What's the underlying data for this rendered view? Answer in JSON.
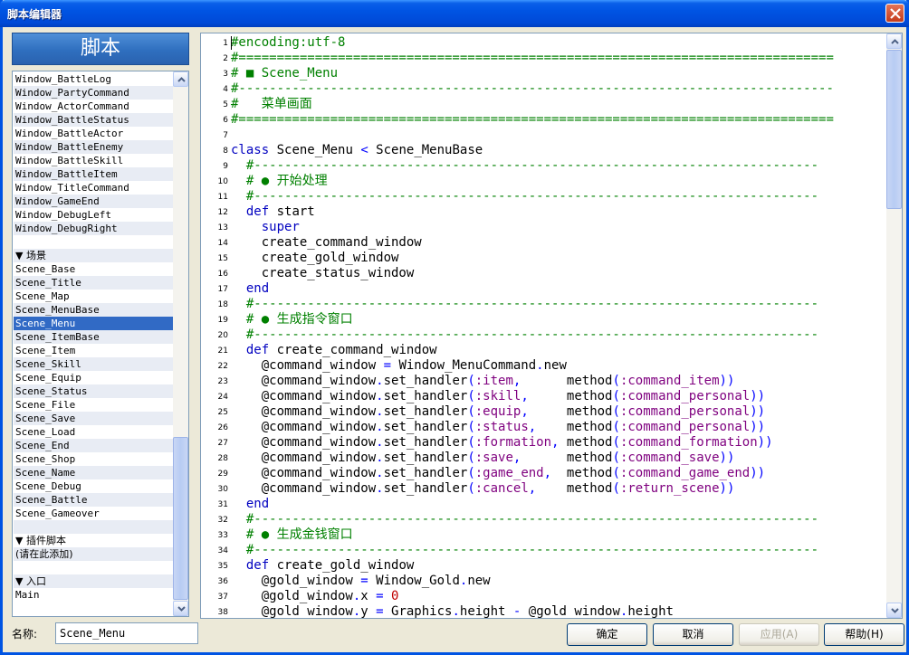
{
  "window": {
    "title": "脚本编辑器"
  },
  "sidebar": {
    "header": "脚本",
    "items": [
      {
        "label": "Window_BattleLog",
        "type": "item"
      },
      {
        "label": "Window_PartyCommand",
        "type": "item"
      },
      {
        "label": "Window_ActorCommand",
        "type": "item"
      },
      {
        "label": "Window_BattleStatus",
        "type": "item"
      },
      {
        "label": "Window_BattleActor",
        "type": "item"
      },
      {
        "label": "Window_BattleEnemy",
        "type": "item"
      },
      {
        "label": "Window_BattleSkill",
        "type": "item"
      },
      {
        "label": "Window_BattleItem",
        "type": "item"
      },
      {
        "label": "Window_TitleCommand",
        "type": "item"
      },
      {
        "label": "Window_GameEnd",
        "type": "item"
      },
      {
        "label": "Window_DebugLeft",
        "type": "item"
      },
      {
        "label": "Window_DebugRight",
        "type": "item"
      },
      {
        "label": "",
        "type": "blank"
      },
      {
        "label": "▼ 场景",
        "type": "group"
      },
      {
        "label": "Scene_Base",
        "type": "item"
      },
      {
        "label": "Scene_Title",
        "type": "item"
      },
      {
        "label": "Scene_Map",
        "type": "item"
      },
      {
        "label": "Scene_MenuBase",
        "type": "item"
      },
      {
        "label": "Scene_Menu",
        "type": "item",
        "selected": true
      },
      {
        "label": "Scene_ItemBase",
        "type": "item"
      },
      {
        "label": "Scene_Item",
        "type": "item"
      },
      {
        "label": "Scene_Skill",
        "type": "item"
      },
      {
        "label": "Scene_Equip",
        "type": "item"
      },
      {
        "label": "Scene_Status",
        "type": "item"
      },
      {
        "label": "Scene_File",
        "type": "item"
      },
      {
        "label": "Scene_Save",
        "type": "item"
      },
      {
        "label": "Scene_Load",
        "type": "item"
      },
      {
        "label": "Scene_End",
        "type": "item"
      },
      {
        "label": "Scene_Shop",
        "type": "item"
      },
      {
        "label": "Scene_Name",
        "type": "item"
      },
      {
        "label": "Scene_Debug",
        "type": "item"
      },
      {
        "label": "Scene_Battle",
        "type": "item"
      },
      {
        "label": "Scene_Gameover",
        "type": "item"
      },
      {
        "label": "",
        "type": "blank"
      },
      {
        "label": "▼ 插件脚本",
        "type": "group"
      },
      {
        "label": "(请在此添加)",
        "type": "group"
      },
      {
        "label": "",
        "type": "blank"
      },
      {
        "label": "▼ 入口",
        "type": "group"
      },
      {
        "label": "Main",
        "type": "item"
      }
    ]
  },
  "editor": {
    "lines": [
      [
        [
          "com",
          "#encoding:utf-8"
        ]
      ],
      [
        [
          "com",
          "#=============================================================================="
        ]
      ],
      [
        [
          "com",
          "# ■ Scene_Menu"
        ]
      ],
      [
        [
          "com",
          "#------------------------------------------------------------------------------"
        ]
      ],
      [
        [
          "com",
          "#   菜单画面"
        ]
      ],
      [
        [
          "com",
          "#=============================================================================="
        ]
      ],
      [],
      [
        [
          "kw",
          "class"
        ],
        [
          "txt",
          " Scene_Menu "
        ],
        [
          "op",
          "<"
        ],
        [
          "txt",
          " Scene_MenuBase"
        ]
      ],
      [
        [
          "com",
          "  #--------------------------------------------------------------------------"
        ]
      ],
      [
        [
          "com",
          "  # ● 开始处理"
        ]
      ],
      [
        [
          "com",
          "  #--------------------------------------------------------------------------"
        ]
      ],
      [
        [
          "kw",
          "  def"
        ],
        [
          "txt",
          " start"
        ]
      ],
      [
        [
          "kw",
          "    super"
        ]
      ],
      [
        [
          "txt",
          "    create_command_window"
        ]
      ],
      [
        [
          "txt",
          "    create_gold_window"
        ]
      ],
      [
        [
          "txt",
          "    create_status_window"
        ]
      ],
      [
        [
          "kw",
          "  end"
        ]
      ],
      [
        [
          "com",
          "  #--------------------------------------------------------------------------"
        ]
      ],
      [
        [
          "com",
          "  # ● 生成指令窗口"
        ]
      ],
      [
        [
          "com",
          "  #--------------------------------------------------------------------------"
        ]
      ],
      [
        [
          "kw",
          "  def"
        ],
        [
          "txt",
          " create_command_window"
        ]
      ],
      [
        [
          "txt",
          "    @command_window "
        ],
        [
          "op",
          "="
        ],
        [
          "txt",
          " Window_MenuCommand"
        ],
        [
          "op",
          "."
        ],
        [
          "txt",
          "new"
        ]
      ],
      [
        [
          "txt",
          "    @command_window"
        ],
        [
          "op",
          "."
        ],
        [
          "txt",
          "set_handler"
        ],
        [
          "op",
          "("
        ],
        [
          "sym",
          ":item"
        ],
        [
          "op",
          ","
        ],
        [
          "txt",
          "      method"
        ],
        [
          "op",
          "("
        ],
        [
          "sym",
          ":command_item"
        ],
        [
          "op",
          "))"
        ]
      ],
      [
        [
          "txt",
          "    @command_window"
        ],
        [
          "op",
          "."
        ],
        [
          "txt",
          "set_handler"
        ],
        [
          "op",
          "("
        ],
        [
          "sym",
          ":skill"
        ],
        [
          "op",
          ","
        ],
        [
          "txt",
          "     method"
        ],
        [
          "op",
          "("
        ],
        [
          "sym",
          ":command_personal"
        ],
        [
          "op",
          "))"
        ]
      ],
      [
        [
          "txt",
          "    @command_window"
        ],
        [
          "op",
          "."
        ],
        [
          "txt",
          "set_handler"
        ],
        [
          "op",
          "("
        ],
        [
          "sym",
          ":equip"
        ],
        [
          "op",
          ","
        ],
        [
          "txt",
          "     method"
        ],
        [
          "op",
          "("
        ],
        [
          "sym",
          ":command_personal"
        ],
        [
          "op",
          "))"
        ]
      ],
      [
        [
          "txt",
          "    @command_window"
        ],
        [
          "op",
          "."
        ],
        [
          "txt",
          "set_handler"
        ],
        [
          "op",
          "("
        ],
        [
          "sym",
          ":status"
        ],
        [
          "op",
          ","
        ],
        [
          "txt",
          "    method"
        ],
        [
          "op",
          "("
        ],
        [
          "sym",
          ":command_personal"
        ],
        [
          "op",
          "))"
        ]
      ],
      [
        [
          "txt",
          "    @command_window"
        ],
        [
          "op",
          "."
        ],
        [
          "txt",
          "set_handler"
        ],
        [
          "op",
          "("
        ],
        [
          "sym",
          ":formation"
        ],
        [
          "op",
          ","
        ],
        [
          "txt",
          " method"
        ],
        [
          "op",
          "("
        ],
        [
          "sym",
          ":command_formation"
        ],
        [
          "op",
          "))"
        ]
      ],
      [
        [
          "txt",
          "    @command_window"
        ],
        [
          "op",
          "."
        ],
        [
          "txt",
          "set_handler"
        ],
        [
          "op",
          "("
        ],
        [
          "sym",
          ":save"
        ],
        [
          "op",
          ","
        ],
        [
          "txt",
          "      method"
        ],
        [
          "op",
          "("
        ],
        [
          "sym",
          ":command_save"
        ],
        [
          "op",
          "))"
        ]
      ],
      [
        [
          "txt",
          "    @command_window"
        ],
        [
          "op",
          "."
        ],
        [
          "txt",
          "set_handler"
        ],
        [
          "op",
          "("
        ],
        [
          "sym",
          ":game_end"
        ],
        [
          "op",
          ","
        ],
        [
          "txt",
          "  method"
        ],
        [
          "op",
          "("
        ],
        [
          "sym",
          ":command_game_end"
        ],
        [
          "op",
          "))"
        ]
      ],
      [
        [
          "txt",
          "    @command_window"
        ],
        [
          "op",
          "."
        ],
        [
          "txt",
          "set_handler"
        ],
        [
          "op",
          "("
        ],
        [
          "sym",
          ":cancel"
        ],
        [
          "op",
          ","
        ],
        [
          "txt",
          "    method"
        ],
        [
          "op",
          "("
        ],
        [
          "sym",
          ":return_scene"
        ],
        [
          "op",
          "))"
        ]
      ],
      [
        [
          "kw",
          "  end"
        ]
      ],
      [
        [
          "com",
          "  #--------------------------------------------------------------------------"
        ]
      ],
      [
        [
          "com",
          "  # ● 生成金钱窗口"
        ]
      ],
      [
        [
          "com",
          "  #--------------------------------------------------------------------------"
        ]
      ],
      [
        [
          "kw",
          "  def"
        ],
        [
          "txt",
          " create_gold_window"
        ]
      ],
      [
        [
          "txt",
          "    @gold_window "
        ],
        [
          "op",
          "="
        ],
        [
          "txt",
          " Window_Gold"
        ],
        [
          "op",
          "."
        ],
        [
          "txt",
          "new"
        ]
      ],
      [
        [
          "txt",
          "    @gold_window"
        ],
        [
          "op",
          "."
        ],
        [
          "txt",
          "x "
        ],
        [
          "op",
          "="
        ],
        [
          "num",
          " 0"
        ]
      ],
      [
        [
          "txt",
          "    @gold_window"
        ],
        [
          "op",
          "."
        ],
        [
          "txt",
          "y "
        ],
        [
          "op",
          "="
        ],
        [
          "txt",
          " Graphics"
        ],
        [
          "op",
          "."
        ],
        [
          "txt",
          "height "
        ],
        [
          "op",
          "-"
        ],
        [
          "txt",
          " @gold_window"
        ],
        [
          "op",
          "."
        ],
        [
          "txt",
          "height"
        ]
      ]
    ]
  },
  "footer": {
    "name_label": "名称:",
    "name_value": "Scene_Menu",
    "ok_label": "确定",
    "cancel_label": "取消",
    "apply_label": "应用(A)",
    "help_label": "帮助(H)"
  }
}
